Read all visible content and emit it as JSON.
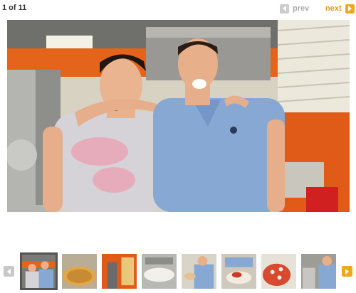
{
  "gallery": {
    "counter": "1 of 11",
    "prev_label": "prev",
    "next_label": "next"
  },
  "colors": {
    "accent": "#f0a81a",
    "disabled": "#cccccc",
    "selected_border": "#555555"
  },
  "photo": {
    "description_icon": "photo-image"
  },
  "thumbnails": [
    {
      "name": "thumb-1",
      "selected": true
    },
    {
      "name": "thumb-2",
      "selected": false
    },
    {
      "name": "thumb-3",
      "selected": false
    },
    {
      "name": "thumb-4",
      "selected": false
    },
    {
      "name": "thumb-5",
      "selected": false
    },
    {
      "name": "thumb-6",
      "selected": false
    },
    {
      "name": "thumb-7",
      "selected": false
    },
    {
      "name": "thumb-8",
      "selected": false
    }
  ]
}
